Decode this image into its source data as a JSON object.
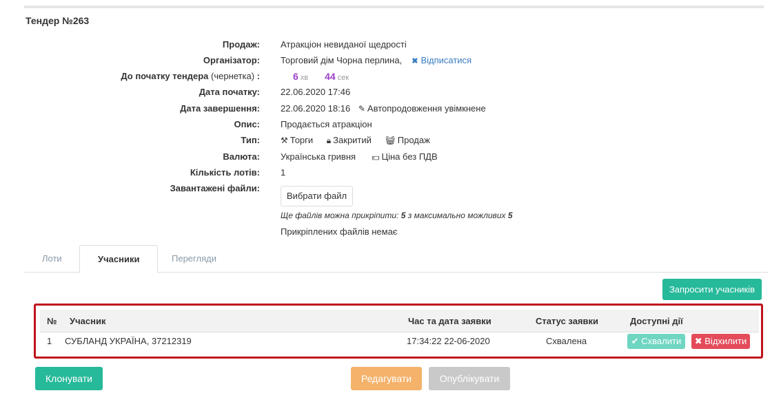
{
  "tender": {
    "title": "Тендер №263"
  },
  "info": {
    "sale": {
      "label": "Продаж:",
      "value": "Атракціон невиданої щедрості"
    },
    "organizer": {
      "label": "Організатор:",
      "value": "Торговий дім Чорна перлина,",
      "unsubscribe_icon": "close-icon",
      "unsubscribe": "Відписатися"
    },
    "countdown": {
      "label": "До початку тендера",
      "label_note": "(чернетка)",
      "label_colon": " :",
      "minutes": "6",
      "minutes_unit": "хв",
      "seconds": "44",
      "seconds_unit": "сек"
    },
    "start_date": {
      "label": "Дата початку:",
      "value": "22.06.2020 17:46"
    },
    "end_date": {
      "label": "Дата завершення:",
      "value": "22.06.2020 18:16",
      "extension_icon": "pencil-icon",
      "extension": "Автопродовження увімкнене"
    },
    "description": {
      "label": "Опис:",
      "value": "Продається атракціон"
    },
    "type": {
      "label": "Тип:",
      "items": [
        {
          "icon": "gavel-icon",
          "text": "Торги"
        },
        {
          "icon": "lock-icon",
          "text": "Закритий"
        },
        {
          "icon": "basket-icon",
          "text": "Продаж"
        }
      ]
    },
    "currency": {
      "label": "Валюта:",
      "value": "Українська гривня",
      "vat_icon": "money-icon",
      "vat": "Ціна без ПДВ"
    },
    "lots_count": {
      "label": "Кількість лотів:",
      "value": "1"
    },
    "files": {
      "label": "Завантажені файли:",
      "choose_button": "Вибрати файл",
      "note_prefix": "Ще файлів можна прикріпити:",
      "remaining": "5",
      "note_middle": "з максимально можливих",
      "max": "5",
      "none_text": "Прикріплених файлів немає"
    }
  },
  "tabs": [
    {
      "label": "Лоти",
      "active": false
    },
    {
      "label": "Учасники",
      "active": true
    },
    {
      "label": "Перегляди",
      "active": false
    }
  ],
  "participants": {
    "invite_button": "Запросити учасників",
    "columns": {
      "num": "№",
      "participant": "Учасник",
      "time": "Час та дата заявки",
      "status": "Статус заявки",
      "actions": "Доступні дії"
    },
    "rows": [
      {
        "num": "1",
        "participant": "СУБЛАНД УКРАЇНА, 37212319",
        "time": "17:34:22  22-06-2020",
        "status": "Схвалена",
        "approve": "Схвалити",
        "reject": "Відхилити"
      }
    ]
  },
  "footer": {
    "clone": "Клонувати",
    "edit": "Редагувати",
    "publish": "Опублікувати"
  },
  "colors": {
    "teal": "#26b99a",
    "teal_light": "#6fd6c1",
    "red": "#e34b5a",
    "highlight_border": "#c0121c",
    "orange": "#f4b26b",
    "grey": "#c9c9c9",
    "purple": "#9b3fc8",
    "link": "#3a7cc1"
  }
}
